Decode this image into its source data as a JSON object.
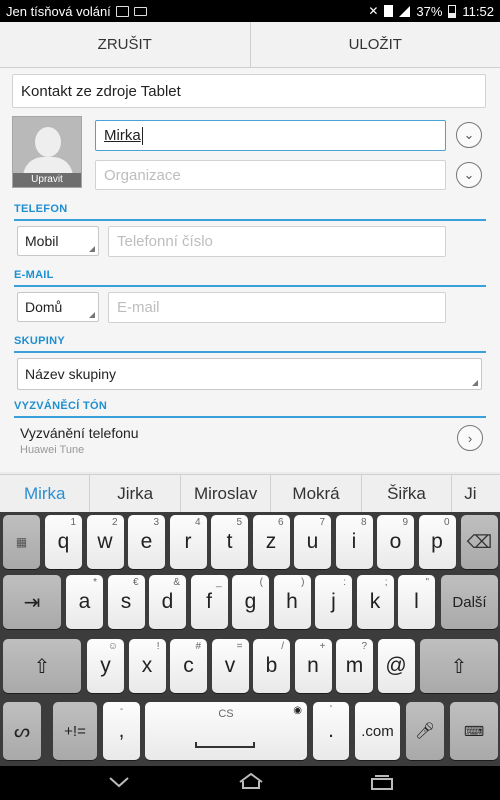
{
  "status_bar": {
    "carrier_text": "Jen tísňová volání",
    "battery_percent": "37%",
    "time": "11:52",
    "icons": [
      "image-icon",
      "keyboard-icon",
      "mute-icon",
      "sim-icon",
      "signal-icon",
      "battery-icon"
    ]
  },
  "action_bar": {
    "cancel_label": "ZRUŠIT",
    "save_label": "ULOŽIT"
  },
  "form": {
    "account": "Kontakt ze zdroje Tablet",
    "photo_caption": "Upravit",
    "name_value": "Mirka",
    "organization_placeholder": "Organizace",
    "phone": {
      "section": "TELEFON",
      "type": "Mobil",
      "placeholder": "Telefonní číslo"
    },
    "email": {
      "section": "E-MAIL",
      "type": "Domů",
      "placeholder": "E-mail"
    },
    "groups": {
      "section": "SKUPINY",
      "value": "Název skupiny"
    },
    "ringtone": {
      "section": "VYZVÁNĚCÍ TÓN",
      "title": "Vyzvánění telefonu",
      "subtitle": "Huawei Tune"
    }
  },
  "suggestions": [
    "Mirka",
    "Jirka",
    "Miroslav",
    "Mokrá",
    "Šiřka",
    "Ji"
  ],
  "keyboard": {
    "row1": [
      {
        "main": "q",
        "hint": "1"
      },
      {
        "main": "w",
        "hint": "2"
      },
      {
        "main": "e",
        "hint": "3"
      },
      {
        "main": "r",
        "hint": "4"
      },
      {
        "main": "t",
        "hint": "5"
      },
      {
        "main": "z",
        "hint": "6"
      },
      {
        "main": "u",
        "hint": "7"
      },
      {
        "main": "i",
        "hint": "8"
      },
      {
        "main": "o",
        "hint": "9"
      },
      {
        "main": "p",
        "hint": "0"
      }
    ],
    "row2": [
      {
        "main": "a",
        "hint": "*"
      },
      {
        "main": "s",
        "hint": "€"
      },
      {
        "main": "d",
        "hint": "&"
      },
      {
        "main": "f",
        "hint": "_"
      },
      {
        "main": "g",
        "hint": "("
      },
      {
        "main": "h",
        "hint": ")"
      },
      {
        "main": "j",
        "hint": ":"
      },
      {
        "main": "k",
        "hint": ";"
      },
      {
        "main": "l",
        "hint": "\""
      }
    ],
    "row3": [
      {
        "main": "y",
        "hint": "☺"
      },
      {
        "main": "x",
        "hint": "!"
      },
      {
        "main": "c",
        "hint": "#"
      },
      {
        "main": "v",
        "hint": "="
      },
      {
        "main": "b",
        "hint": "/"
      },
      {
        "main": "n",
        "hint": "+"
      },
      {
        "main": "m",
        "hint": "?"
      },
      {
        "main": "@",
        "hint": ""
      }
    ],
    "next_label": "Další",
    "symbols_label": "+!=",
    "comma_label": ",",
    "comma_hint": "-",
    "space_label": "CS",
    "period_label": ".",
    "period_hint": "'",
    "dotcom_label": ".com"
  }
}
